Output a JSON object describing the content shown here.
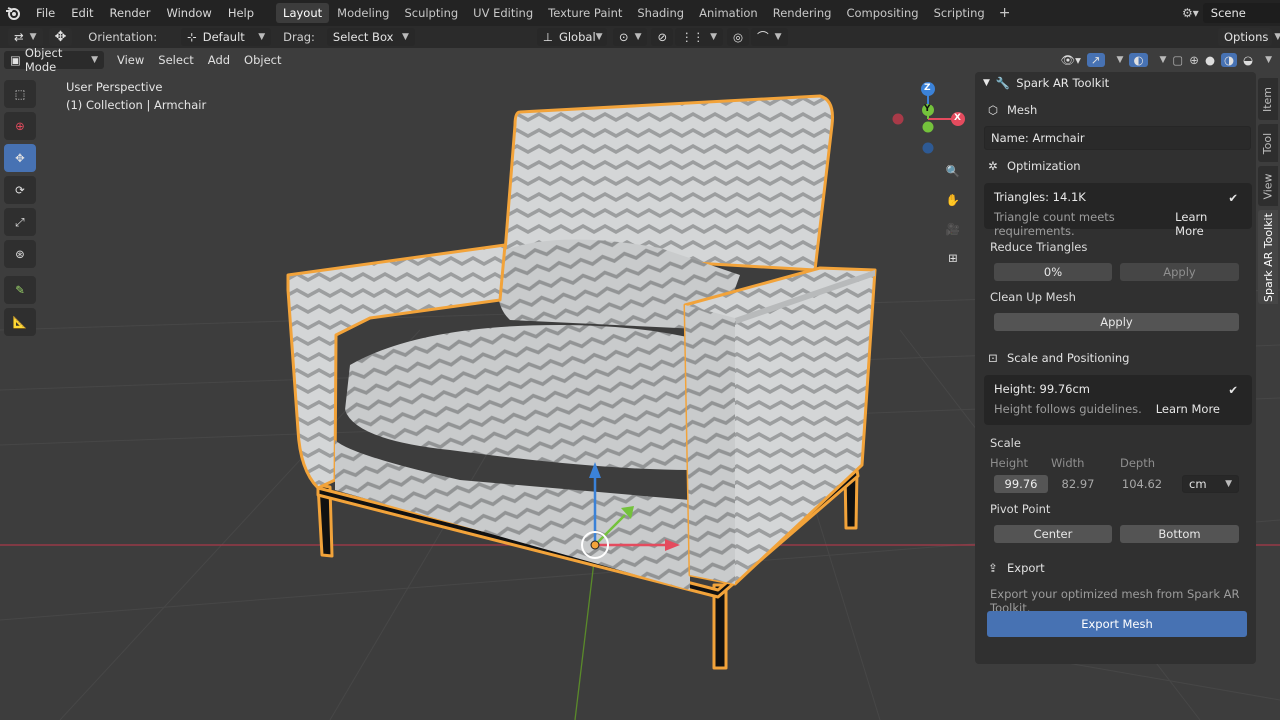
{
  "menu": {
    "items": [
      "File",
      "Edit",
      "Render",
      "Window",
      "Help"
    ],
    "workspaces": [
      "Layout",
      "Modeling",
      "Sculpting",
      "UV Editing",
      "Texture Paint",
      "Shading",
      "Animation",
      "Rendering",
      "Compositing",
      "Scripting"
    ],
    "active_workspace": "Layout",
    "scene": "Scene"
  },
  "tool_header": {
    "orientation_label": "Orientation:",
    "orientation_value": "Default",
    "drag_label": "Drag:",
    "drag_value": "Select Box",
    "transform_orientation": "Global",
    "options": "Options"
  },
  "view_header": {
    "mode": "Object Mode",
    "menus": [
      "View",
      "Select",
      "Add",
      "Object"
    ]
  },
  "viewport": {
    "perspective": "User Perspective",
    "collection": "(1) Collection | Armchair",
    "gizmo": {
      "z": "Z",
      "y": "Y",
      "x": "X"
    }
  },
  "sidebar_tabs": [
    "Item",
    "Tool",
    "View",
    "Spark AR Toolkit"
  ],
  "active_sidebar_tab": "Spark AR Toolkit",
  "panel": {
    "title": "Spark AR Toolkit",
    "mesh_section": "Mesh",
    "name_field": "Name: Armchair",
    "optimization_section": "Optimization",
    "triangles": {
      "title": "Triangles: 14.1K",
      "status": "Triangle count meets requirements.",
      "learn_more": "Learn More"
    },
    "reduce_triangles": {
      "label": "Reduce Triangles",
      "value": "0%",
      "apply": "Apply"
    },
    "clean_up": {
      "label": "Clean Up Mesh",
      "apply": "Apply"
    },
    "scale_section": "Scale and Positioning",
    "height_card": {
      "title": "Height: 99.76cm",
      "status": "Height follows guidelines.",
      "learn_more": "Learn More"
    },
    "scale": {
      "label": "Scale",
      "height_label": "Height",
      "width_label": "Width",
      "depth_label": "Depth",
      "height": "99.76",
      "width": "82.97",
      "depth": "104.62",
      "unit": "cm"
    },
    "pivot": {
      "label": "Pivot Point",
      "center": "Center",
      "bottom": "Bottom"
    },
    "export_section": "Export",
    "export_hint": "Export your optimized mesh from Spark AR Toolkit.",
    "export_button": "Export Mesh"
  },
  "colors": {
    "accent": "#4772b3",
    "selection_outline": "#f2a33a",
    "x_axis": "#e44b5e",
    "y_axis": "#74c23c",
    "z_axis": "#3b82d8"
  }
}
